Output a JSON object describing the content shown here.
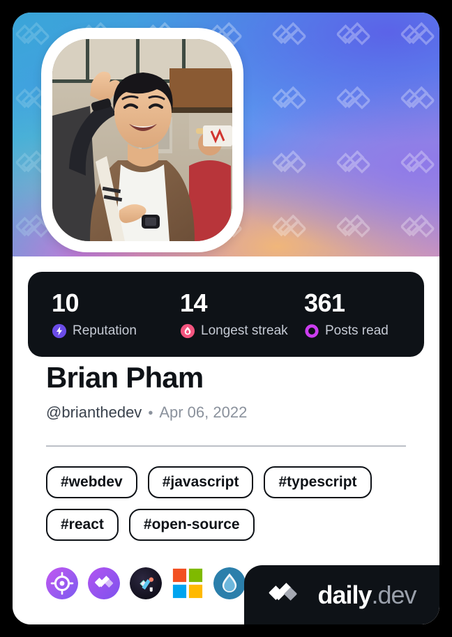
{
  "card": {
    "type": "devcard",
    "theme_bg": "#ffffff",
    "dark_panel": "#0e1217"
  },
  "cover": {
    "pattern_icon": "daily-dev-logo-watermark",
    "gradient_colors": [
      "#3aa0d8",
      "#4a9ae8",
      "#5f95f0",
      "#9a8fe0",
      "#c08ad0",
      "#e070d8",
      "#f0b67a",
      "#5ed3c2",
      "#5b63e8"
    ]
  },
  "avatar": {
    "alt": "profile-photo",
    "description": "Smiling person with raised hand wearing brown jacket over white t-shirt"
  },
  "stats": [
    {
      "value": "10",
      "label": "Reputation",
      "icon": "bolt-icon",
      "color": "#6b4ce8"
    },
    {
      "value": "14",
      "label": "Longest streak",
      "icon": "flame-icon",
      "color": "#f4557f"
    },
    {
      "value": "361",
      "label": "Posts read",
      "icon": "ring-icon",
      "color": "#cc3df0"
    }
  ],
  "profile": {
    "name": "Brian Pham",
    "handle": "@brianthedev",
    "separator": "•",
    "joined": "Apr 06, 2022"
  },
  "tags": [
    {
      "label": "#webdev"
    },
    {
      "label": "#javascript"
    },
    {
      "label": "#typescript"
    },
    {
      "label": "#react"
    },
    {
      "label": "#open-source"
    }
  ],
  "badges": [
    {
      "name": "target-badge-icon",
      "title": "Target badge",
      "color": "#b44ef0"
    },
    {
      "name": "daily-dev-badge-icon",
      "title": "daily.dev badge",
      "color": "#a24ef0"
    },
    {
      "name": "streak-badge-icon",
      "title": "Dark badge",
      "color": "#1a1726"
    },
    {
      "name": "microsoft-badge-icon",
      "title": "Microsoft",
      "color": "#f25022"
    },
    {
      "name": "droplet-badge-icon",
      "title": "Droplet badge",
      "color": "#2b7fab"
    }
  ],
  "brand": {
    "mark": "daily-dev-logo-icon",
    "name": "daily",
    "suffix": ".dev"
  }
}
